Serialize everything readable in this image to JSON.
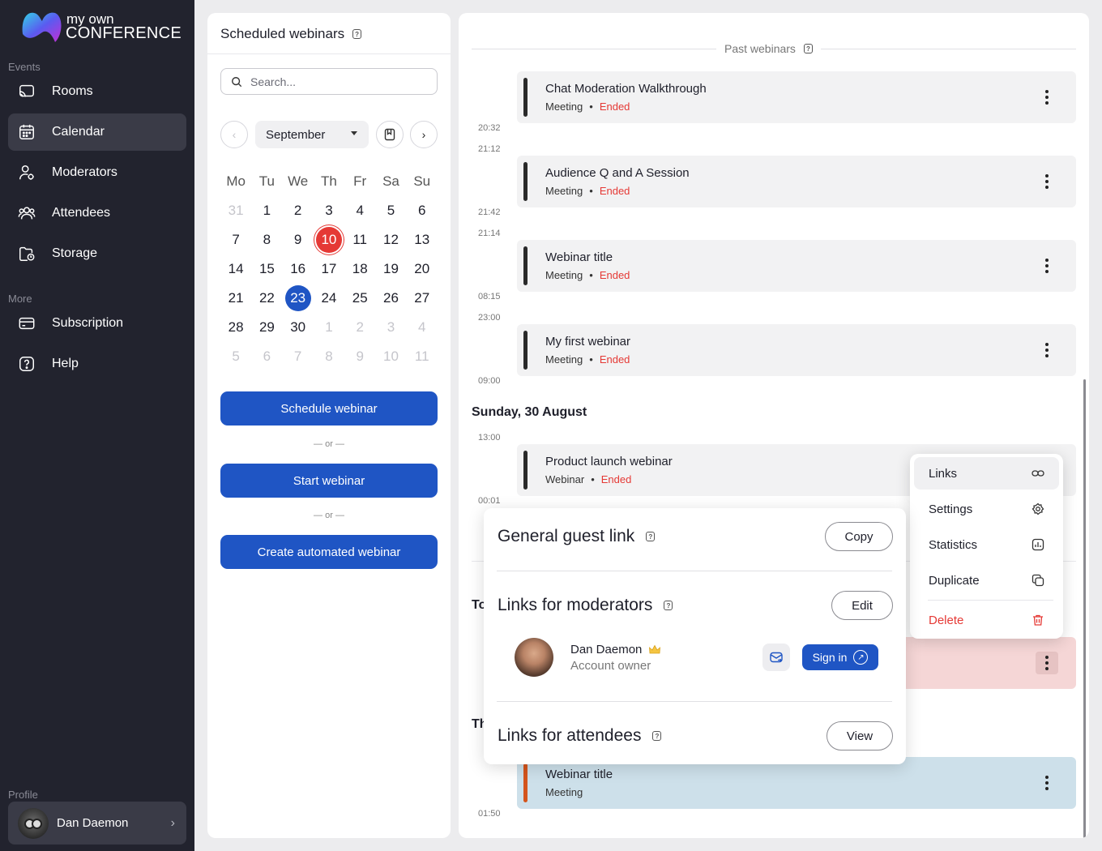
{
  "brand": {
    "line1": "my own",
    "line2": "CONFERENCE"
  },
  "sidebar": {
    "events_label": "Events",
    "more_label": "More",
    "profile_label": "Profile",
    "items": [
      {
        "label": "Rooms",
        "icon": "cast-icon"
      },
      {
        "label": "Calendar",
        "icon": "calendar-icon",
        "active": true
      },
      {
        "label": "Moderators",
        "icon": "moderator-icon"
      },
      {
        "label": "Attendees",
        "icon": "attendees-icon"
      },
      {
        "label": "Storage",
        "icon": "folder-icon"
      }
    ],
    "more_items": [
      {
        "label": "Subscription",
        "icon": "card-icon"
      },
      {
        "label": "Help",
        "icon": "help-icon"
      }
    ],
    "profile": {
      "name": "Dan Daemon"
    }
  },
  "scheduled": {
    "title": "Scheduled webinars",
    "search_placeholder": "Search...",
    "month": "September",
    "weekdays": [
      "Mo",
      "Tu",
      "We",
      "Th",
      "Fr",
      "Sa",
      "Su"
    ],
    "weeks": [
      [
        "31",
        "1",
        "2",
        "3",
        "4",
        "5",
        "6"
      ],
      [
        "7",
        "8",
        "9",
        "10",
        "11",
        "12",
        "13"
      ],
      [
        "14",
        "15",
        "16",
        "17",
        "18",
        "19",
        "20"
      ],
      [
        "21",
        "22",
        "23",
        "24",
        "25",
        "26",
        "27"
      ],
      [
        "28",
        "29",
        "30",
        "1",
        "2",
        "3",
        "4"
      ],
      [
        "5",
        "6",
        "7",
        "8",
        "9",
        "10",
        "11"
      ]
    ],
    "today": "10",
    "selected": "23",
    "schedule_btn": "Schedule webinar",
    "or_text": "— or —",
    "start_btn": "Start webinar",
    "automated_btn": "Create automated webinar"
  },
  "past": {
    "label": "Past webinars",
    "events": [
      {
        "title": "Chat Moderation Walkthrough",
        "type": "Meeting",
        "status": "Ended",
        "start": "",
        "end": "20:32"
      },
      {
        "title": "Audience Q and A Session",
        "type": "Meeting",
        "status": "Ended",
        "start": "21:12",
        "end": "21:42"
      },
      {
        "title": "Webinar title",
        "type": "Meeting",
        "status": "Ended",
        "start": "21:14",
        "end": "08:15"
      },
      {
        "title": "My first webinar",
        "type": "Meeting",
        "status": "Ended",
        "start": "23:00",
        "end": "09:00"
      }
    ],
    "day_heading": "Sunday, 30 August",
    "day_event": {
      "title": "Product launch webinar",
      "type": "Webinar",
      "status": "Ended",
      "start": "13:00",
      "end": "00:01"
    },
    "partial_heading_1": "To",
    "partial_heading_2": "Th",
    "bottom_event": {
      "title": "Webinar title",
      "type": "Meeting",
      "end": "01:50"
    }
  },
  "context_menu": {
    "items": [
      "Links",
      "Settings",
      "Statistics",
      "Duplicate"
    ],
    "delete": "Delete"
  },
  "links_popup": {
    "guest_title": "General guest link",
    "copy": "Copy",
    "moderators_title": "Links for moderators",
    "edit": "Edit",
    "moderator": {
      "name": "Dan Daemon",
      "role": "Account owner"
    },
    "sign_in": "Sign in",
    "attendees_title": "Links for attendees",
    "view": "View"
  },
  "colors": {
    "accent": "#1f55c4",
    "danger": "#e53935",
    "sidebar": "#22232e"
  }
}
